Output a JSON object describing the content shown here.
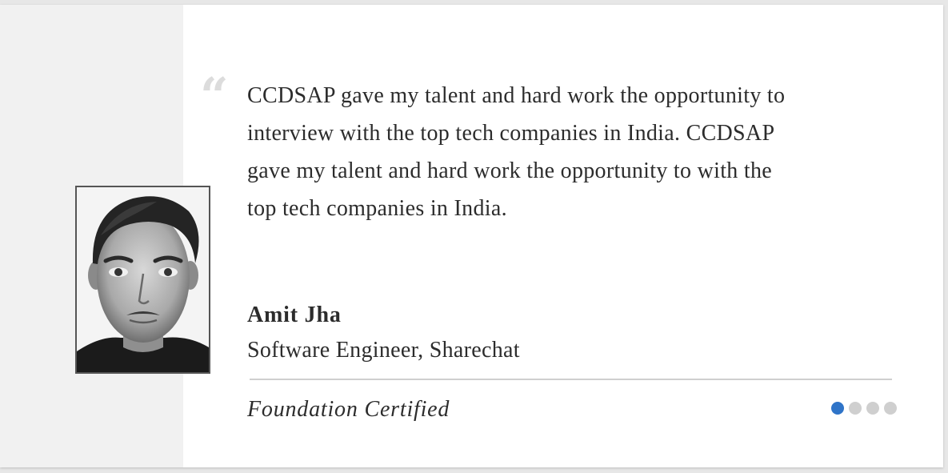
{
  "testimonial": {
    "quote_mark": "“",
    "quote": "CCDSAP gave my talent and hard work the opportunity to interview with the top tech companies in India. CCDSAP gave my talent and hard work the opportunity to with the top tech companies in India.",
    "author_name": "Amit Jha",
    "author_role": "Software Engineer, Sharechat",
    "certification": "Foundation Certified"
  },
  "carousel": {
    "total_slides": 4,
    "active_index": 0,
    "active_color": "#2f74c8",
    "inactive_color": "#cfcfcf"
  },
  "colors": {
    "left_panel": "#f1f1f1",
    "text": "#2c2c2c",
    "quote_mark": "#dcdcdc"
  }
}
